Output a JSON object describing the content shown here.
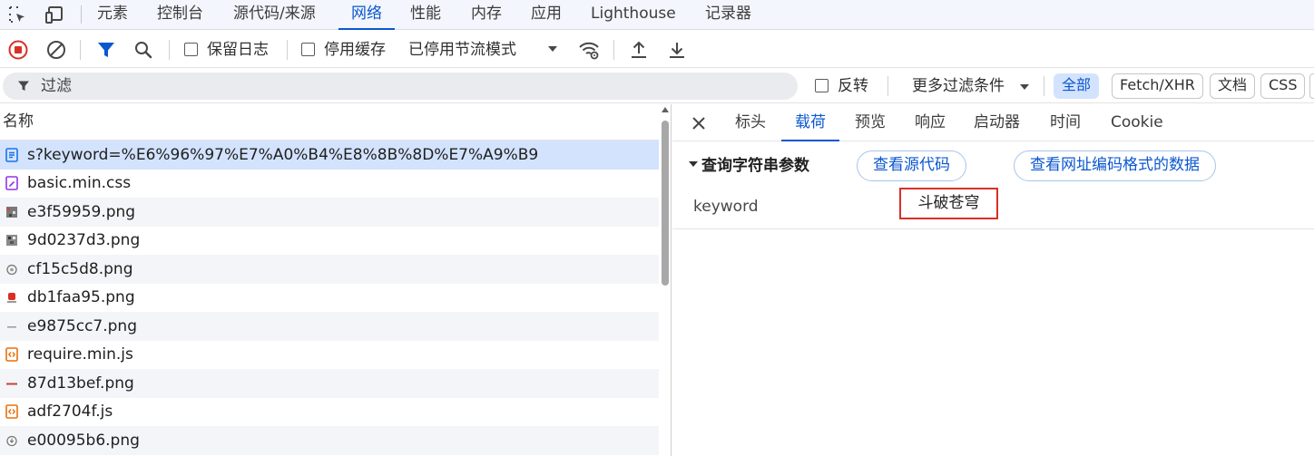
{
  "topbar": {
    "tabs": [
      "元素",
      "控制台",
      "源代码/来源",
      "网络",
      "性能",
      "内存",
      "应用",
      "Lighthouse",
      "记录器"
    ],
    "active_tab": "网络"
  },
  "toolbar": {
    "preserve_log_label": "保留日志",
    "disable_cache_label": "停用缓存",
    "throttling_label": "已停用节流模式"
  },
  "filter": {
    "placeholder": "过滤",
    "invert_label": "反转",
    "more_filters_label": "更多过滤条件",
    "types": [
      "全部",
      "Fetch/XHR",
      "文档",
      "CSS"
    ],
    "active_type": "全部"
  },
  "request_list": {
    "column_header": "名称",
    "rows": [
      {
        "name": "s?keyword=%E6%96%97%E7%A0%B4%E8%8B%8D%E7%A9%B9",
        "icon": "document-icon",
        "selected": true
      },
      {
        "name": "basic.min.css",
        "icon": "stylesheet-icon"
      },
      {
        "name": "e3f59959.png",
        "icon": "image-icon"
      },
      {
        "name": "9d0237d3.png",
        "icon": "image-icon"
      },
      {
        "name": "cf15c5d8.png",
        "icon": "image-icon"
      },
      {
        "name": "db1faa95.png",
        "icon": "image-icon"
      },
      {
        "name": "e9875cc7.png",
        "icon": "image-icon"
      },
      {
        "name": "require.min.js",
        "icon": "script-icon"
      },
      {
        "name": "87d13bef.png",
        "icon": "image-icon"
      },
      {
        "name": "adf2704f.js",
        "icon": "script-icon"
      },
      {
        "name": "e00095b6.png",
        "icon": "image-icon"
      }
    ]
  },
  "detail": {
    "tabs": [
      "标头",
      "载荷",
      "预览",
      "响应",
      "启动器",
      "时间",
      "Cookie"
    ],
    "active_tab": "载荷",
    "section_title": "查询字符串参数",
    "view_source_label": "查看源代码",
    "view_url_encoded_label": "查看网址编码格式的数据",
    "params": [
      {
        "key": "keyword",
        "value": "斗破苍穹"
      }
    ]
  },
  "colors": {
    "accent": "#0b57d0",
    "record_red": "#d93025",
    "highlight_border": "#d93025",
    "selected_row": "#d3e3fd"
  }
}
